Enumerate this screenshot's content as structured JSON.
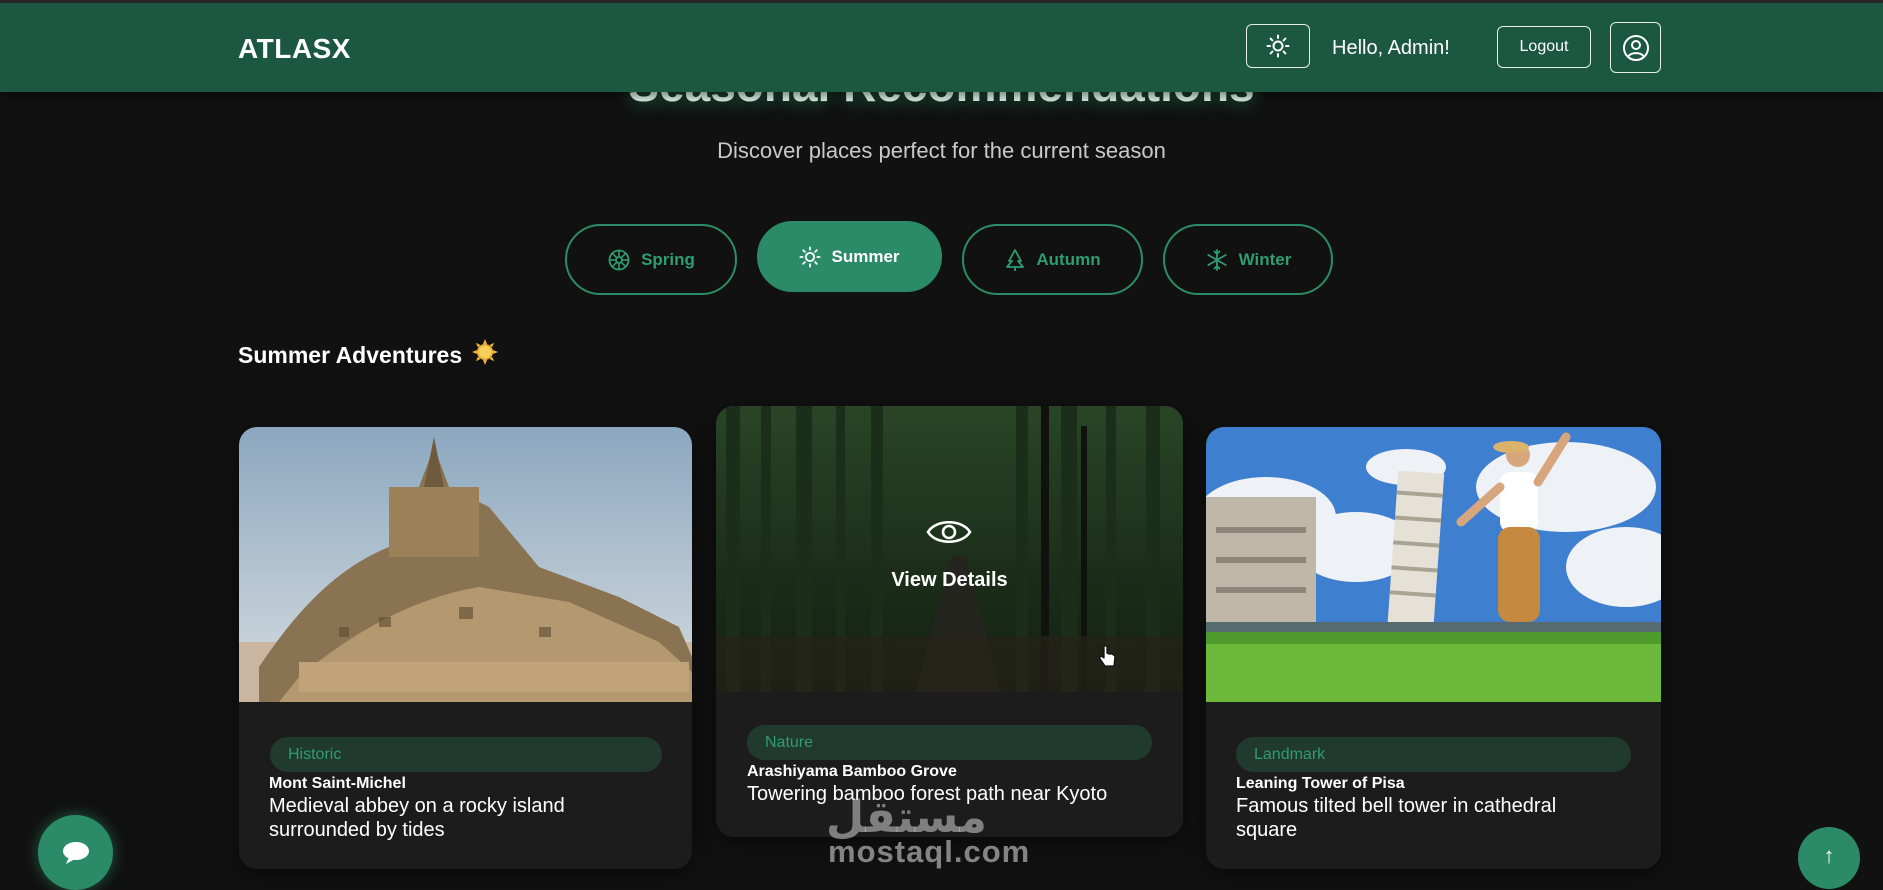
{
  "navbar": {
    "brand": "ATLASX",
    "greeting": "Hello, Admin!",
    "logout_label": "Logout",
    "theme_icon": "sun-icon",
    "profile_icon": "user-circle-icon"
  },
  "header": {
    "title": "Seasonal Recommendations",
    "subtitle": "Discover places perfect for the current season"
  },
  "seasons": [
    {
      "label": "Spring",
      "icon": "flower-icon",
      "active": false
    },
    {
      "label": "Summer",
      "icon": "sun-icon",
      "active": true
    },
    {
      "label": "Autumn",
      "icon": "tree-icon",
      "active": false
    },
    {
      "label": "Winter",
      "icon": "snowflake-icon",
      "active": false
    }
  ],
  "section": {
    "title": "Summer Adventures",
    "emoji": "🌞"
  },
  "cards": [
    {
      "tag": "Historic",
      "name": "Mont Saint-Michel",
      "description_line1": "Medieval abbey on a rocky island",
      "description_line2": "surrounded by tides"
    },
    {
      "tag": "Nature",
      "name": "Arashiyama Bamboo Grove",
      "description_line1": "Towering bamboo forest path near Kyoto",
      "description_line2": "",
      "overlay_label": "View Details",
      "hovered": true
    },
    {
      "tag": "Landmark",
      "name": "Leaning Tower of Pisa",
      "description_line1": "Famous tilted bell tower in cathedral",
      "description_line2": "square"
    }
  ],
  "watermark": {
    "logo_text": "مستقل",
    "site": "mostaql.com"
  },
  "scroll_top_symbol": "↑",
  "colors": {
    "navbar": "#1b5741",
    "accent": "#2b8a68",
    "background": "#111111",
    "card": "#1c1c1c"
  }
}
